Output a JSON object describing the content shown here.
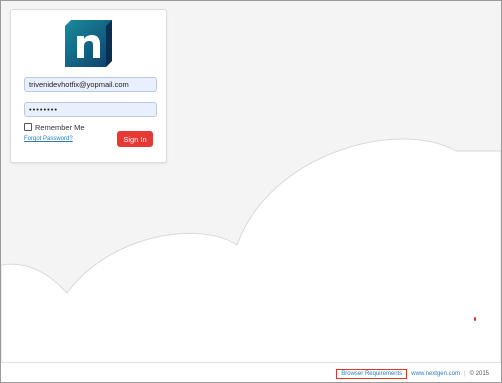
{
  "login": {
    "email_value": "trivenidevhotfix@yopmail.com",
    "password_value": "••••••••",
    "remember_label": "Remember Me",
    "forgot_label": "Forgot Password?",
    "signin_label": "Sign In"
  },
  "footer": {
    "browser_requirements": "Browser Requirements",
    "site_link": "www.nextgen.com",
    "separator": "|",
    "copyright": "© 2015"
  },
  "colors": {
    "signin_button": "#e53935",
    "link": "#2a7dbf",
    "logo_dark": "#0d3f6e",
    "logo_teal": "#1b8b9a"
  },
  "icons": {
    "logo": "nextgen-n-logo",
    "checkbox": "checkbox-unchecked"
  }
}
